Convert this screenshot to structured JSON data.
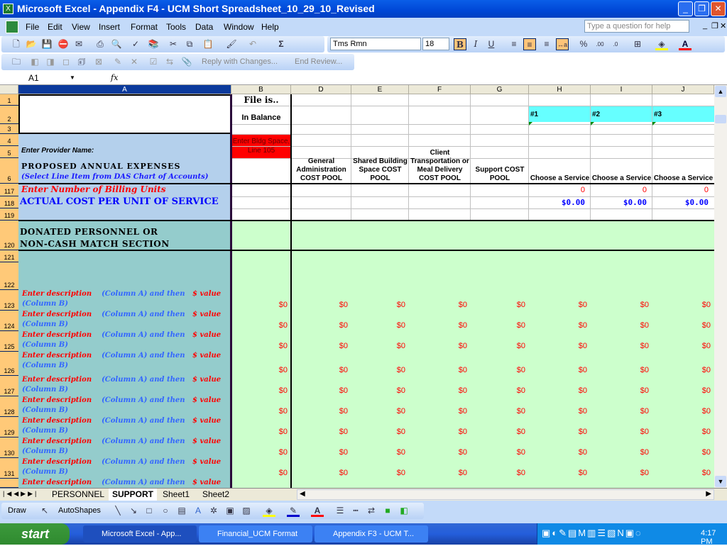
{
  "window": {
    "title": "Microsoft Excel - Appendix F4 - UCM Short Spreadsheet_10_29_10_Revised"
  },
  "menu": [
    "File",
    "Edit",
    "View",
    "Insert",
    "Format",
    "Tools",
    "Data",
    "Window",
    "Help"
  ],
  "help_placeholder": "Type a question for help",
  "formatting": {
    "font": "Tms Rmn",
    "size": "18",
    "bold_active": true,
    "align_center_active": true
  },
  "review": {
    "reply": "Reply with Changes...",
    "end": "End Review..."
  },
  "namebox": "A1",
  "fx": "fx",
  "columns": [
    "A",
    "B",
    "D",
    "E",
    "F",
    "G",
    "H",
    "I",
    "J"
  ],
  "cells": {
    "b1": "File is..",
    "b2": "In Balance",
    "b4": "Enter Bldg Space, Line 105",
    "a5": "Enter Provider Name:",
    "a6_title": "PROPOSED ANNUAL EXPENSES",
    "a6_sub": "(Select Line Item from DAS Chart of Accounts)",
    "d6": "General Administration COST POOL",
    "e6": "Shared Building Space COST POOL",
    "f6": "Client Transportation or Meal Delivery COST POOL",
    "g6": "Support COST POOL",
    "h2": "#1",
    "i2": "#2",
    "j2": "#3",
    "service": "Choose a Service",
    "a117": "Enter Number of Billing Units",
    "a118": "ACTUAL COST PER UNIT OF SERVICE",
    "units": "0",
    "cost": "$0.00",
    "a120_1": "DONATED PERSONNEL OR",
    "a120_2": "NON-CASH MATCH SECTION",
    "desc_red1": "Enter description",
    "desc_blue1": "(Column A) and then",
    "desc_red2": "$ value",
    "desc_blue2": "(Column B)",
    "zero": "$0"
  },
  "rows": [
    "1",
    "2",
    "3",
    "4",
    "5",
    "6",
    "117",
    "118",
    "119",
    "120",
    "121",
    "122",
    "123",
    "124",
    "125",
    "126",
    "127",
    "128",
    "129",
    "130",
    "131"
  ],
  "sheet_tabs": [
    "PERSONNEL",
    "SUPPORT",
    "Sheet1",
    "Sheet2"
  ],
  "active_sheet": "SUPPORT",
  "draw": {
    "draw": "Draw",
    "autoshapes": "AutoShapes"
  },
  "taskbar": {
    "start": "start",
    "tasks": [
      "Microsoft Excel - App...",
      "Financial_UCM Format",
      "Appendix F3 - UCM T..."
    ],
    "clock": "4:17 PM"
  },
  "colors": {
    "row_header": "#FFC978",
    "input_blue": "#B4D0EC",
    "teal": "#94CCCC",
    "green": "#CCFFCC",
    "cyan": "#66FFFF",
    "red": "#FF0000"
  }
}
